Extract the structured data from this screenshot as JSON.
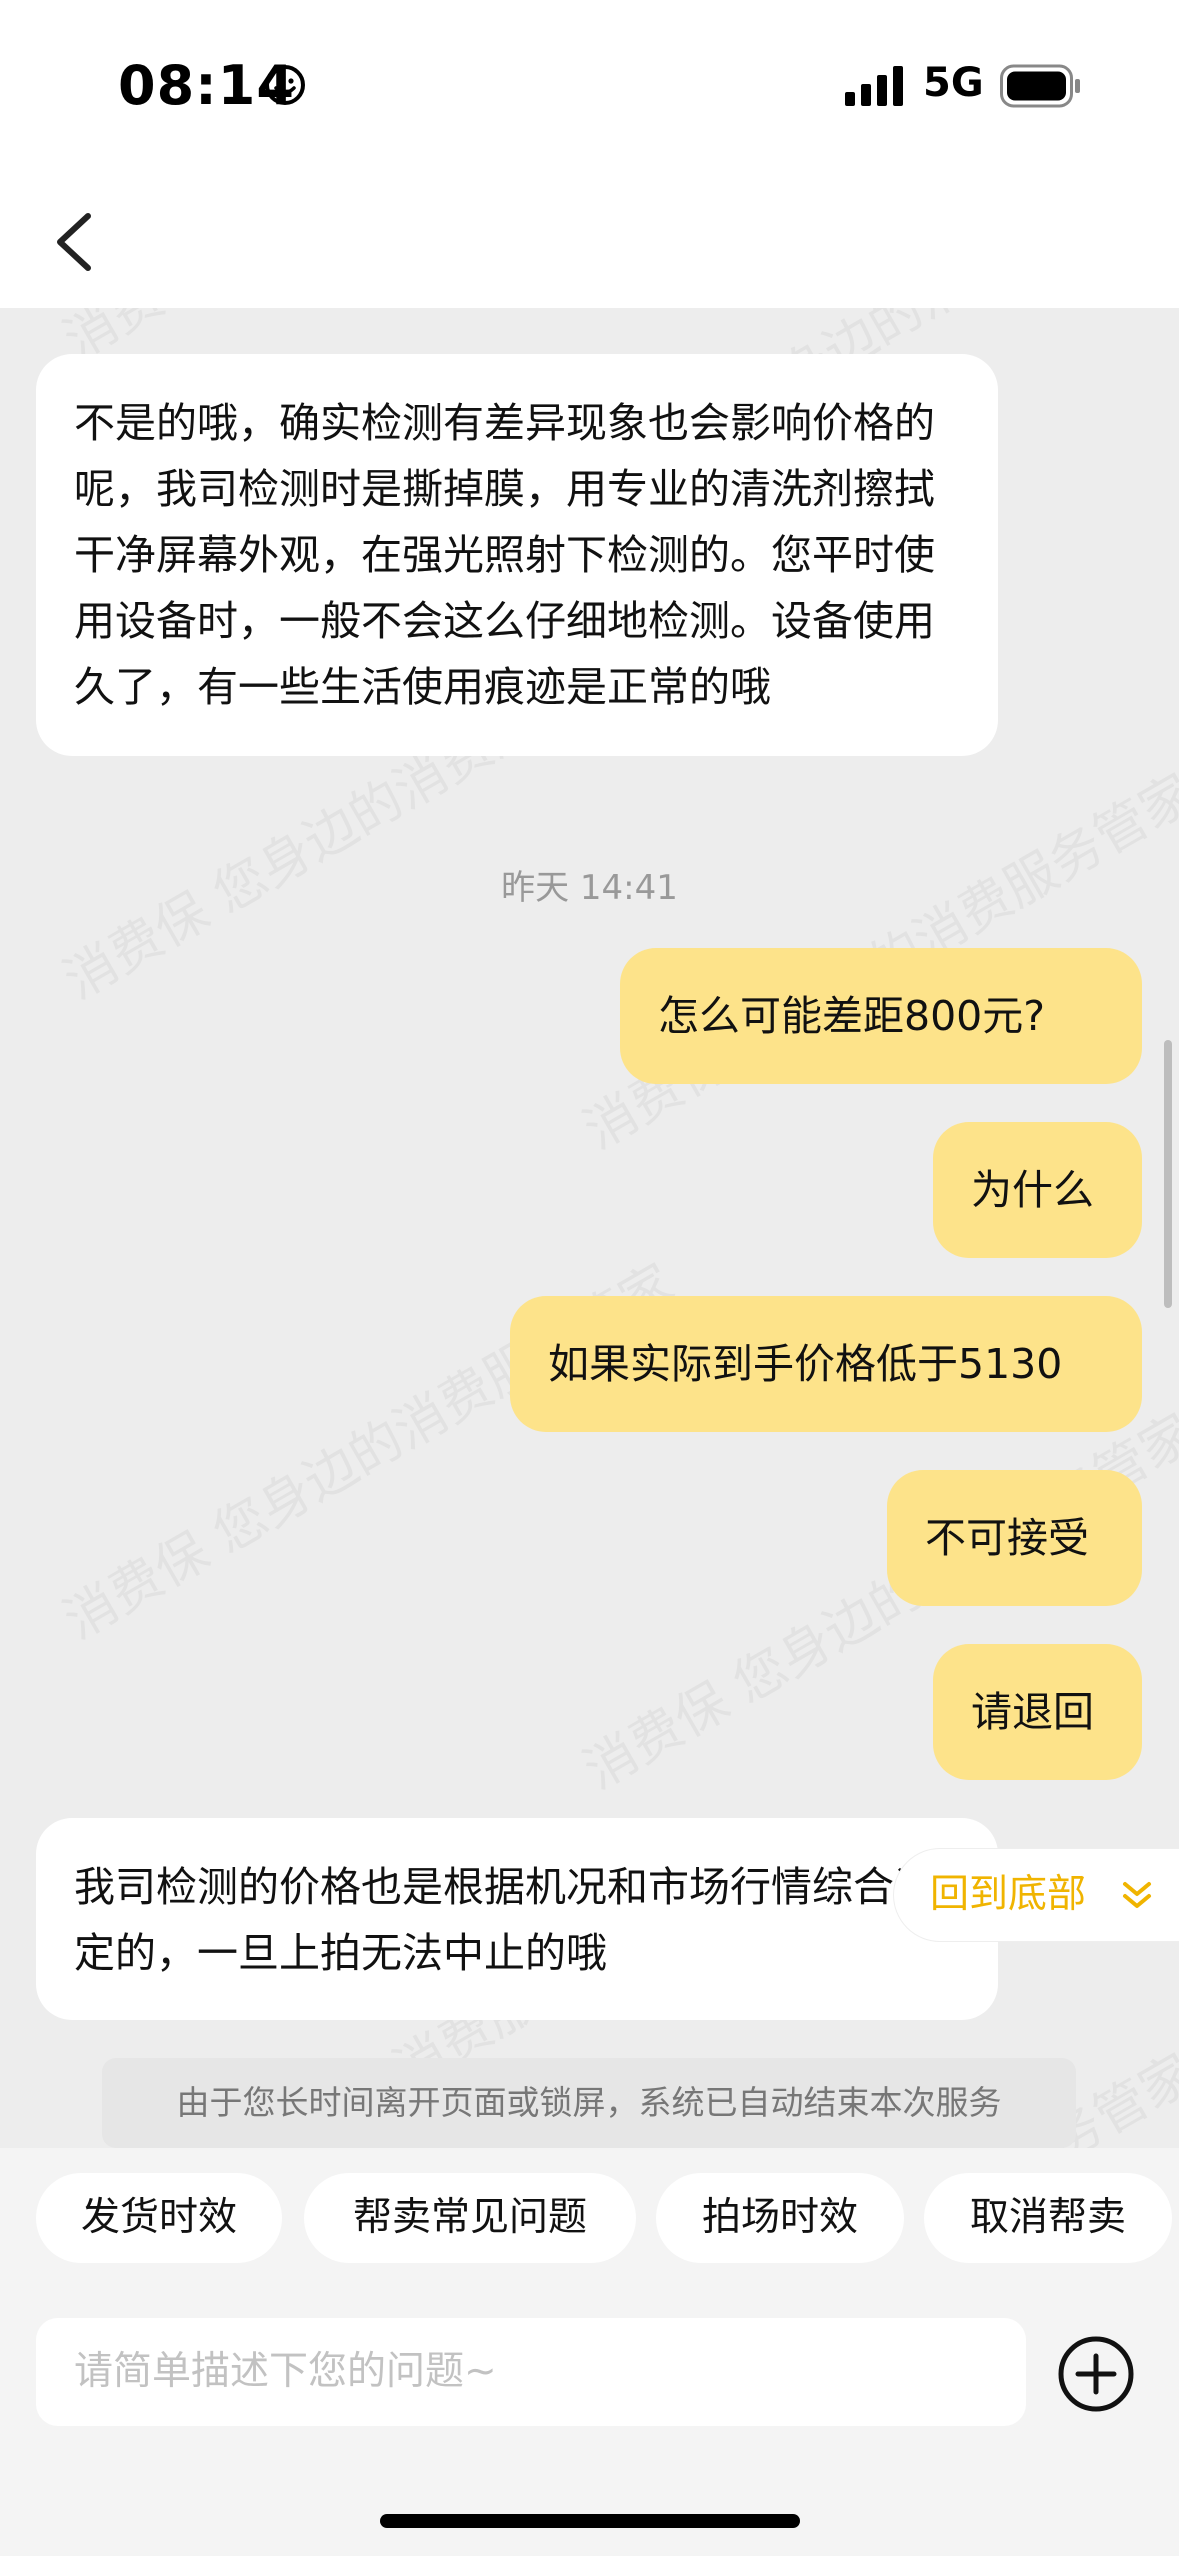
{
  "status_bar": {
    "time": "08:14",
    "network": "5G"
  },
  "watermark": "消费保 您身边的消费服务管家",
  "messages": [
    {
      "side": "left",
      "text": "不是的哦，确实检测有差异现象也会影响价格的呢，我司检测时是撕掉膜，用专业的清洗剂擦拭干净屏幕外观，在强光照射下检测的。您平时使用设备时，一般不会这么仔细地检测。设备使用久了，有一些生活使用痕迹是正常的哦"
    },
    {
      "side": "time",
      "text": "昨天 14:41"
    },
    {
      "side": "right",
      "text": "怎么可能差距800元?"
    },
    {
      "side": "right",
      "text": "为什么"
    },
    {
      "side": "right",
      "text": "如果实际到手价格低于5130"
    },
    {
      "side": "right",
      "text": "不可接受"
    },
    {
      "side": "right",
      "text": "请退回"
    },
    {
      "side": "left",
      "text": "我司检测的价格也是根据机况和市场行情综合评定的，一旦上拍无法中止的哦"
    }
  ],
  "system_notice": "由于您长时间离开页面或锁屏，系统已自动结束本次服务",
  "back_to_bottom": "回到底部",
  "quick_chips": [
    "发货时效",
    "帮卖常见问题",
    "拍场时效",
    "取消帮卖"
  ],
  "input": {
    "placeholder": "请简单描述下您的问题~"
  },
  "colors": {
    "user_bubble": "#fde38a",
    "accent": "#f0b400",
    "background": "#ededed"
  }
}
